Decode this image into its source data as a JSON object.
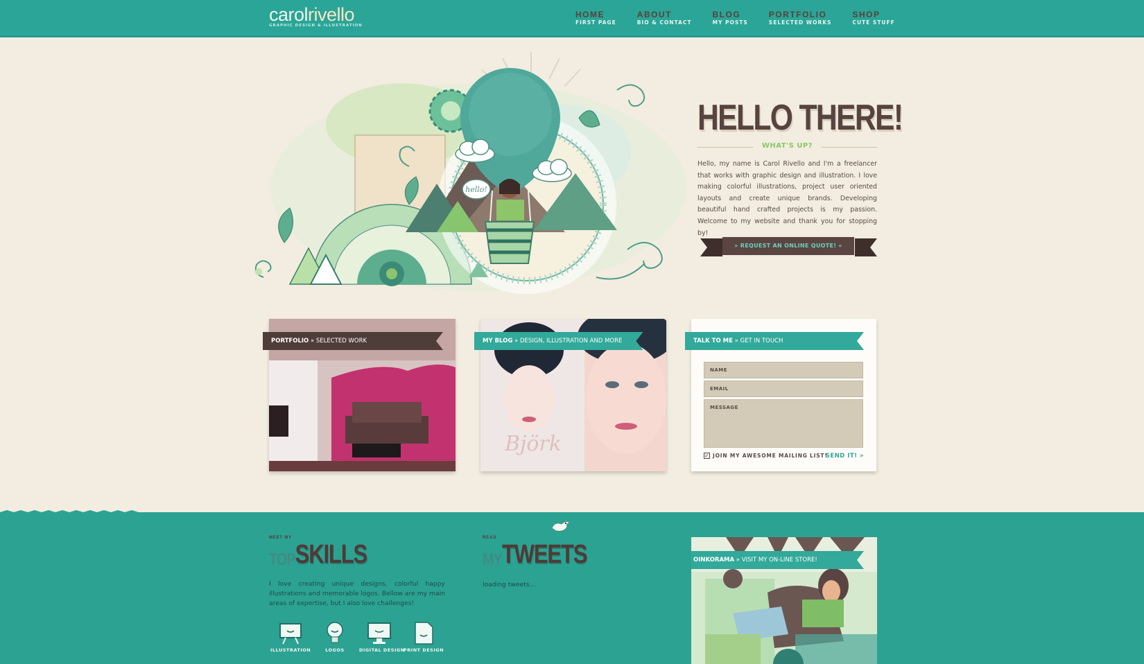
{
  "header": {
    "logo_part1": "carol",
    "logo_part2": "rivello",
    "logo_tagline": "GRAPHIC DESIGN & ILLUSTRATION",
    "nav": [
      {
        "label": "HOME",
        "sub": "FIRST PAGE"
      },
      {
        "label": "ABOUT",
        "sub": "BIO & CONTACT"
      },
      {
        "label": "BLOG",
        "sub": "MY POSTS"
      },
      {
        "label": "PORTFOLIO",
        "sub": "SELECTED WORKS"
      },
      {
        "label": "SHOP",
        "sub": "CUTE STUFF"
      }
    ]
  },
  "hero": {
    "balloon_text": "hello!",
    "title": "HELLO THERE!",
    "subtitle": "WHAT'S UP?",
    "intro": "Hello, my name is Carol Rivello and I'm a freelancer that works with graphic design and illustration. I love making colorful illustrations, project user oriented layouts and create unique brands. Developing beautiful hand crafted projects is my passion. Welcome to my website and thank you for stopping by!",
    "cta": "»  REQUEST AN ONLINE QUOTE!  «"
  },
  "cards": {
    "portfolio": {
      "title": "PORTFOLIO",
      "sub": " » SELECTED WORK"
    },
    "blog": {
      "title": "MY BLOG",
      "sub": " » DESIGN, ILLUSTRATION AND MORE"
    },
    "contact": {
      "title": "TALK TO ME",
      "sub": " » GET IN TOUCH",
      "name_placeholder": "NAME",
      "email_placeholder": "EMAIL",
      "message_placeholder": "MESSAGE",
      "mailing": "JOIN MY AWESOME MAILING LIST!",
      "send": "SEND IT! »"
    }
  },
  "skills": {
    "kicker": "MEET MY",
    "prefix": "TOP",
    "title": "SKILLS",
    "text": "I love creating unique designs, colorful happy illustrations and memorable logos. Bellow are my main areas of expertise, but I also love challenges!",
    "items": [
      {
        "label": "ILLUSTRATION",
        "icon": "easel-icon"
      },
      {
        "label": "LOGOS",
        "icon": "lightbulb-icon"
      },
      {
        "label": "DIGITAL DESIGN",
        "icon": "monitor-icon"
      },
      {
        "label": "PRINT DESIGN",
        "icon": "document-icon"
      }
    ]
  },
  "tweets": {
    "kicker": "READ",
    "prefix": "MY",
    "title": "TWEETS",
    "status": "loading tweets..."
  },
  "store": {
    "title": "OINKORAMA",
    "sub": " » VISIT MY ON-LINE STORE!"
  },
  "colors": {
    "teal": "#2aa597",
    "brown": "#574340",
    "cream": "#f2ede0",
    "green": "#8cc665"
  }
}
